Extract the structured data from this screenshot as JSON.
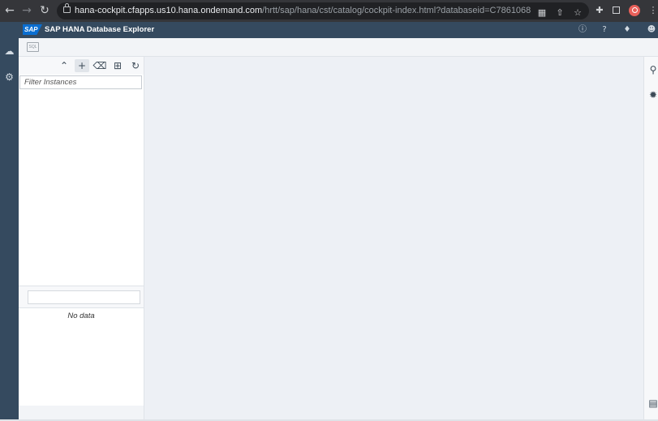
{
  "browser": {
    "url_host": "hana-cockpit.cfapps.us10.hana.ondemand.com",
    "url_path": "/hrtt/sap/hana/cst/catalog/cockpit-index.html?databaseid=C7861068",
    "icons": [
      "arrow-left-icon",
      "arrow-right-icon",
      "reload-icon",
      "lock-icon",
      "translate-icon",
      "share-icon",
      "star-icon",
      "extensions-icon",
      "sidepanel-icon",
      "profile-icon",
      "menu-icon"
    ]
  },
  "shell": {
    "logo": "SAP",
    "title": "SAP HANA Database Explorer",
    "icons": [
      "info-icon",
      "help-icon",
      "notification-icon",
      "user-icon"
    ]
  },
  "left_nav": {
    "icons": [
      "database-explorer-icon",
      "settings-icon"
    ]
  },
  "toolbar": {
    "icons": [
      "sql-console-icon"
    ]
  },
  "instances": {
    "toolbar_icons": [
      "collapse-icon",
      "add-icon",
      "delete-icon",
      "add-group-icon",
      "refresh-icon"
    ],
    "filter_placeholder": "Filter Instances",
    "empty_text": "No data"
  },
  "right_rail": {
    "icons": [
      "search-icon",
      "debug-icon",
      "console-icon"
    ]
  },
  "colors": {
    "shell": "#354a5f",
    "browser_chrome": "#35363a",
    "sap_blue": "#0a6ed1",
    "background": "#edf0f5"
  }
}
